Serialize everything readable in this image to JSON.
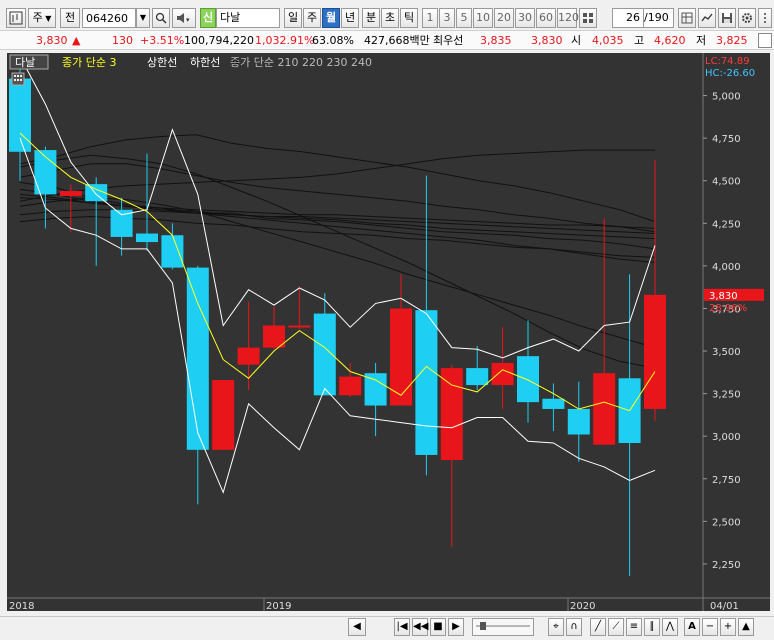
{
  "toolbar": {
    "period_label": "주",
    "prev_label": "전",
    "code_value": "064260",
    "stock_badge": "신",
    "stock_name": "다날",
    "timeframes": [
      "일",
      "주",
      "월",
      "년"
    ],
    "active_timeframe": "월",
    "intraday": [
      "분",
      "초",
      "틱"
    ],
    "intervals": [
      "1",
      "3",
      "5",
      "10",
      "20",
      "30",
      "60",
      "120"
    ],
    "page_counter": "26",
    "page_total": "/190"
  },
  "quote": {
    "price": "3,830",
    "arrow": "▲",
    "change": "130",
    "change_pct": "+3.51%",
    "volume": "100,794,220",
    "volume_pct": "1,032.91%",
    "turnover_pct": "63.08%",
    "amount": "427,668백만",
    "best_label": "최우선",
    "best_ask": "3,835",
    "best_bid": "3,830",
    "open_label": "시",
    "open": "4,035",
    "high_label": "고",
    "high": "4,620",
    "low_label": "저",
    "low": "3,825"
  },
  "legend": {
    "badge": "다날",
    "ma_label": "종가 단순 3",
    "upper_label": "상한선",
    "lower_label": "하한선",
    "long_ma_label": "종가 단순 210  220  230  240"
  },
  "axis": {
    "lc": "LC:74.89",
    "hc": "HC:-26.60",
    "price_badge": "3,830",
    "pct_badge": "28.96%",
    "y_ticks": [
      "5,000",
      "4,750",
      "4,500",
      "4,250",
      "4,000",
      "3,750",
      "3,500",
      "3,250",
      "3,000",
      "2,750",
      "2,500",
      "2,250"
    ],
    "x_labels": [
      "2018",
      "2019",
      "2020",
      "04/01"
    ]
  },
  "colors": {
    "up": "#e8151b",
    "down": "#1ecff3",
    "background": "#333333",
    "ma": "#ffff22",
    "envelope": "#ffffff",
    "long_ma": "#111111"
  },
  "chart_data": {
    "type": "candlestick",
    "ylim": [
      2050,
      5250
    ],
    "candles": [
      {
        "o": 5100,
        "h": 5180,
        "l": 4500,
        "c": 4670
      },
      {
        "o": 4680,
        "h": 4700,
        "l": 4220,
        "c": 4420
      },
      {
        "o": 4410,
        "h": 4480,
        "l": 4200,
        "c": 4440
      },
      {
        "o": 4480,
        "h": 4520,
        "l": 4000,
        "c": 4380
      },
      {
        "o": 4330,
        "h": 4400,
        "l": 4060,
        "c": 4170
      },
      {
        "o": 4190,
        "h": 4660,
        "l": 4090,
        "c": 4140
      },
      {
        "o": 4180,
        "h": 4250,
        "l": 3980,
        "c": 3990
      },
      {
        "o": 3990,
        "h": 4000,
        "l": 2600,
        "c": 2920
      },
      {
        "o": 2920,
        "h": 3330,
        "l": 2920,
        "c": 3330
      },
      {
        "o": 3420,
        "h": 3790,
        "l": 3270,
        "c": 3520
      },
      {
        "o": 3520,
        "h": 3760,
        "l": 3510,
        "c": 3650
      },
      {
        "o": 3650,
        "h": 3880,
        "l": 3630,
        "c": 3650
      },
      {
        "o": 3720,
        "h": 3840,
        "l": 3420,
        "c": 3240
      },
      {
        "o": 3240,
        "h": 3430,
        "l": 3230,
        "c": 3350
      },
      {
        "o": 3370,
        "h": 3430,
        "l": 3000,
        "c": 3180
      },
      {
        "o": 3180,
        "h": 3950,
        "l": 3180,
        "c": 3750
      },
      {
        "o": 3740,
        "h": 4530,
        "l": 2770,
        "c": 2890
      },
      {
        "o": 2860,
        "h": 3420,
        "l": 2350,
        "c": 3400
      },
      {
        "o": 3400,
        "h": 3530,
        "l": 3270,
        "c": 3300
      },
      {
        "o": 3300,
        "h": 3640,
        "l": 3160,
        "c": 3430
      },
      {
        "o": 3470,
        "h": 3680,
        "l": 3080,
        "c": 3200
      },
      {
        "o": 3220,
        "h": 3310,
        "l": 3030,
        "c": 3160
      },
      {
        "o": 3160,
        "h": 3320,
        "l": 2850,
        "c": 3010
      },
      {
        "o": 2950,
        "h": 4280,
        "l": 2950,
        "c": 3370
      },
      {
        "o": 3340,
        "h": 3950,
        "l": 2180,
        "c": 2960
      },
      {
        "o": 3160,
        "h": 4620,
        "l": 3090,
        "c": 3830
      }
    ],
    "ma3": [
      4780,
      4640,
      4520,
      4450,
      4390,
      4320,
      4180,
      3780,
      3450,
      3340,
      3500,
      3620,
      3520,
      3380,
      3330,
      3240,
      3410,
      3300,
      3260,
      3390,
      3330,
      3250,
      3160,
      3200,
      3150,
      3380
    ],
    "upper": [
      5230,
      4950,
      4610,
      4420,
      4300,
      4330,
      4800,
      4420,
      3650,
      3860,
      3770,
      3870,
      3800,
      3640,
      3780,
      3810,
      3720,
      3520,
      3510,
      3460,
      3520,
      3570,
      3500,
      3650,
      3670,
      4120
    ],
    "lower": [
      4750,
      4340,
      4220,
      4180,
      4100,
      4100,
      3900,
      3020,
      2670,
      3190,
      3050,
      2920,
      3280,
      3120,
      3100,
      3080,
      3060,
      3050,
      3110,
      3110,
      2970,
      2960,
      2870,
      2820,
      2740,
      2800
    ],
    "long_ma": [
      [
        4490,
        4460,
        4400,
        4360,
        4340,
        4310,
        4310,
        4280,
        4270,
        4260,
        4240,
        4220,
        4200,
        4190,
        4180,
        4160,
        4150,
        4130,
        4100
      ],
      [
        4450,
        4420,
        4380,
        4350,
        4330,
        4310,
        4300,
        4290,
        4280,
        4270,
        4250,
        4240,
        4220,
        4210,
        4200,
        4190,
        4180,
        4170,
        4160
      ],
      [
        4420,
        4400,
        4370,
        4350,
        4330,
        4320,
        4300,
        4290,
        4290,
        4280,
        4270,
        4260,
        4250,
        4240,
        4230,
        4220,
        4210,
        4200,
        4190
      ],
      [
        4400,
        4390,
        4370,
        4350,
        4340,
        4330,
        4320,
        4310,
        4300,
        4300,
        4290,
        4280,
        4270,
        4260,
        4250,
        4240,
        4240,
        4230,
        4220
      ],
      [
        4600,
        4640,
        4700,
        4740,
        4760,
        4770,
        4720,
        4690,
        4670,
        4640,
        4610,
        4580,
        4540,
        4500,
        4470,
        4430,
        4380,
        4330,
        4260
      ],
      [
        4520,
        4560,
        4600,
        4600,
        4570,
        4530,
        4490,
        4460,
        4440,
        4420,
        4400,
        4380,
        4350,
        4330,
        4300,
        4280,
        4250,
        4230,
        4200
      ],
      [
        4380,
        4420,
        4450,
        4470,
        4480,
        4490,
        4500,
        4510,
        4520,
        4540,
        4570,
        4600,
        4630,
        4650,
        4660,
        4670,
        4680,
        4680,
        4680
      ],
      [
        4300,
        4320,
        4330,
        4330,
        4320,
        4310,
        4290,
        4270,
        4250,
        4230,
        4210,
        4190,
        4170,
        4150,
        4120,
        4100,
        4070,
        4040,
        4020
      ],
      [
        4350,
        4380,
        4400,
        4390,
        4360,
        4320,
        4260,
        4200,
        4140,
        4080,
        4020,
        3950,
        3890,
        3830,
        3770,
        3710,
        3640,
        3580,
        3520
      ],
      [
        4580,
        4620,
        4650,
        4630,
        4600,
        4540,
        4460,
        4380,
        4290,
        4200,
        4110,
        4020,
        3920,
        3820,
        3720,
        3610,
        3510,
        3440,
        3400
      ],
      [
        4260,
        4280,
        4290,
        4280,
        4270,
        4250,
        4240,
        4220,
        4200,
        4190,
        4180,
        4160,
        4150,
        4130,
        4110,
        4100,
        4080,
        4060,
        4050
      ]
    ]
  }
}
